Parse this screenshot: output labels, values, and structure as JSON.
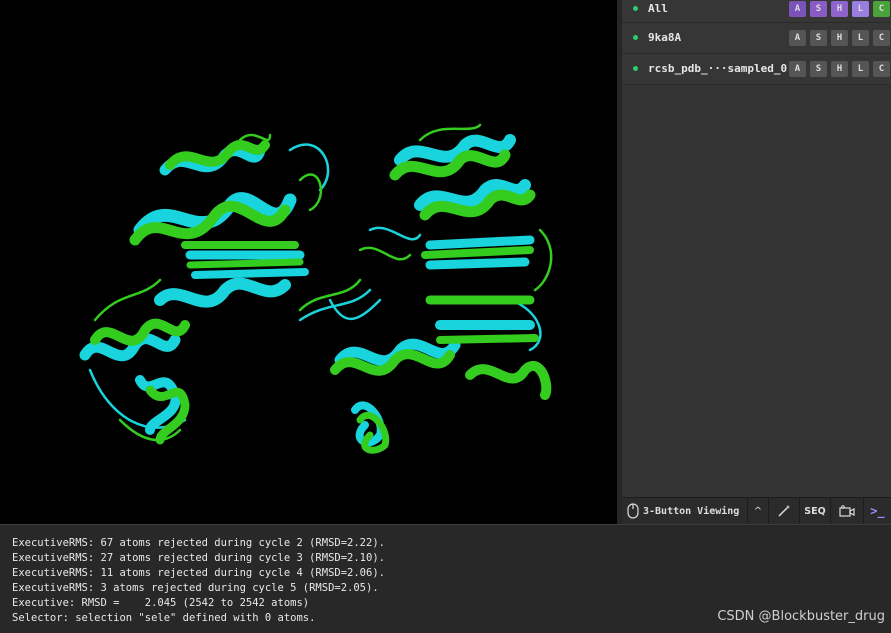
{
  "objects": [
    {
      "name": "All",
      "buttons": [
        "A",
        "S",
        "H",
        "L",
        "C"
      ],
      "active": true
    },
    {
      "name": "9ka8A",
      "buttons": [
        "A",
        "S",
        "H",
        "L",
        "C"
      ],
      "active": false
    },
    {
      "name": "rcsb_pdb_···sampled_0",
      "buttons": [
        "A",
        "S",
        "H",
        "L",
        "C"
      ],
      "active": false
    }
  ],
  "button_colors": {
    "A": "#7b52b8",
    "S": "#8a5bc4",
    "H": "#8e63cc",
    "L": "#9a7de0",
    "C": "#4aa33a",
    "inactive": "#555555"
  },
  "toolbar": {
    "mouse_mode": "3-Button Viewing",
    "chevron": "^",
    "seq_label": "SEQ",
    "prompt_icon": ">_"
  },
  "console": {
    "lines": [
      "ExecutiveRMS: 67 atoms rejected during cycle 2 (RMSD=2.22).",
      "ExecutiveRMS: 27 atoms rejected during cycle 3 (RMSD=2.10).",
      "ExecutiveRMS: 11 atoms rejected during cycle 4 (RMSD=2.06).",
      "ExecutiveRMS: 3 atoms rejected during cycle 5 (RMSD=2.05).",
      "Executive: RMSD =    2.045 (2542 to 2542 atoms)",
      "Selector: selection \"sele\" defined with 0 atoms."
    ]
  },
  "watermark": "CSDN @Blockbuster_drug",
  "structure_colors": {
    "green": "#33cc1f",
    "cyan": "#19d3dd"
  }
}
